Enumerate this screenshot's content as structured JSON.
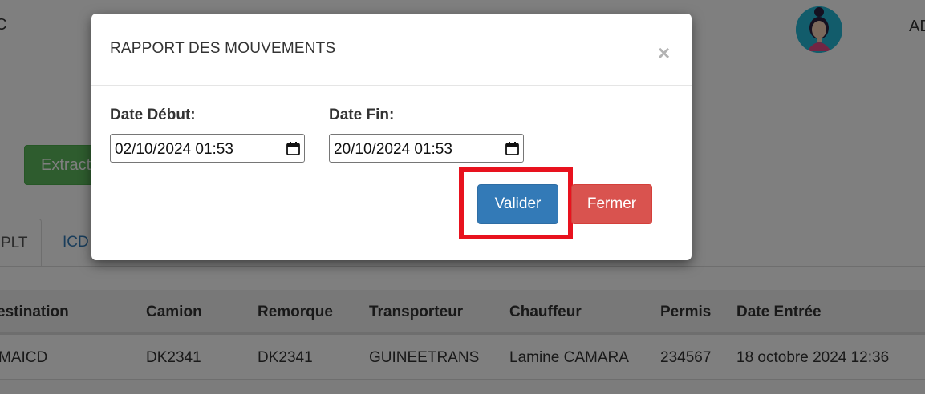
{
  "background": {
    "header_fragment": "C",
    "user_fragment": "AD",
    "extract_button": "Extract",
    "tabs": [
      "PLT",
      "ICD"
    ],
    "table": {
      "headers": [
        "estination",
        "Camion",
        "Remorque",
        "Transporteur",
        "Chauffeur",
        "Permis",
        "Date Entrée"
      ],
      "rows": [
        [
          "MAICD",
          "DK2341",
          "DK2341",
          "GUINEETRANS",
          "Lamine CAMARA",
          "234567",
          "18 octobre 2024 12:36"
        ]
      ]
    }
  },
  "modal": {
    "title": "RAPPORT DES MOUVEMENTS",
    "close_symbol": "×",
    "start_label": "Date Début:",
    "start_value": "02/10/2024 01:53",
    "end_label": "Date Fin:",
    "end_value": "20/10/2024 01:53",
    "validate_label": "Valider",
    "close_label": "Fermer"
  },
  "colors": {
    "primary": "#337ab7",
    "danger": "#d9534f",
    "success": "#5cb85c",
    "highlight": "#e8121e"
  }
}
